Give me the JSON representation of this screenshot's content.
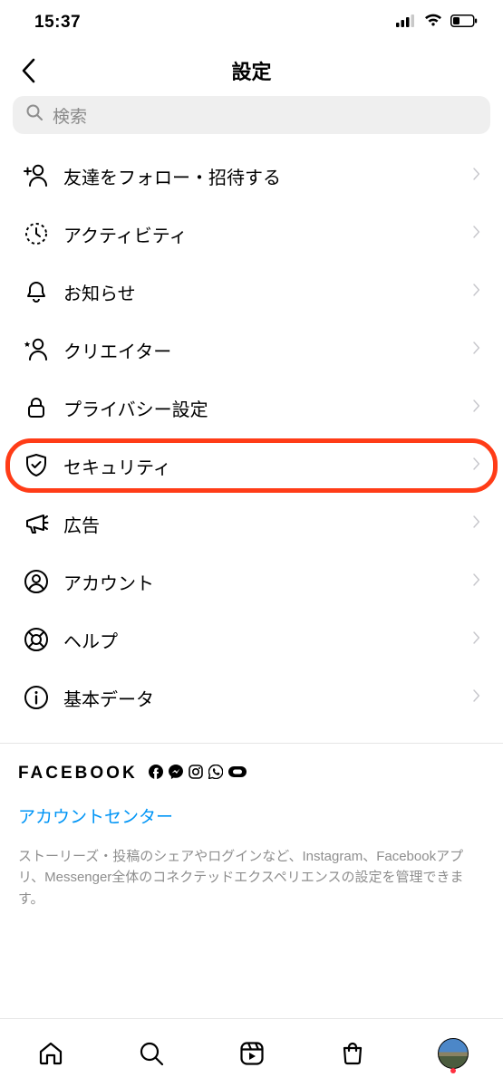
{
  "status": {
    "time": "15:37"
  },
  "header": {
    "title": "設定"
  },
  "search": {
    "placeholder": "検索"
  },
  "menu": [
    {
      "key": "follow-invite",
      "icon": "add-user-icon",
      "label": "友達をフォロー・招待する",
      "highlight": false
    },
    {
      "key": "activity",
      "icon": "activity-icon",
      "label": "アクティビティ",
      "highlight": false
    },
    {
      "key": "notifications",
      "icon": "bell-icon",
      "label": "お知らせ",
      "highlight": false
    },
    {
      "key": "creator",
      "icon": "star-user-icon",
      "label": "クリエイター",
      "highlight": false
    },
    {
      "key": "privacy",
      "icon": "lock-icon",
      "label": "プライバシー設定",
      "highlight": false
    },
    {
      "key": "security",
      "icon": "shield-icon",
      "label": "セキュリティ",
      "highlight": true
    },
    {
      "key": "ads",
      "icon": "megaphone-icon",
      "label": "広告",
      "highlight": false
    },
    {
      "key": "account",
      "icon": "account-icon",
      "label": "アカウント",
      "highlight": false
    },
    {
      "key": "help",
      "icon": "help-icon",
      "label": "ヘルプ",
      "highlight": false
    },
    {
      "key": "about",
      "icon": "info-icon",
      "label": "基本データ",
      "highlight": false
    }
  ],
  "facebook": {
    "brand": "FACEBOOK",
    "account_center": "アカウントセンター",
    "description": "ストーリーズ・投稿のシェアやログインなど、Instagram、Facebookアプリ、Messenger全体のコネクテッドエクスペリエンスの設定を管理できます。"
  }
}
